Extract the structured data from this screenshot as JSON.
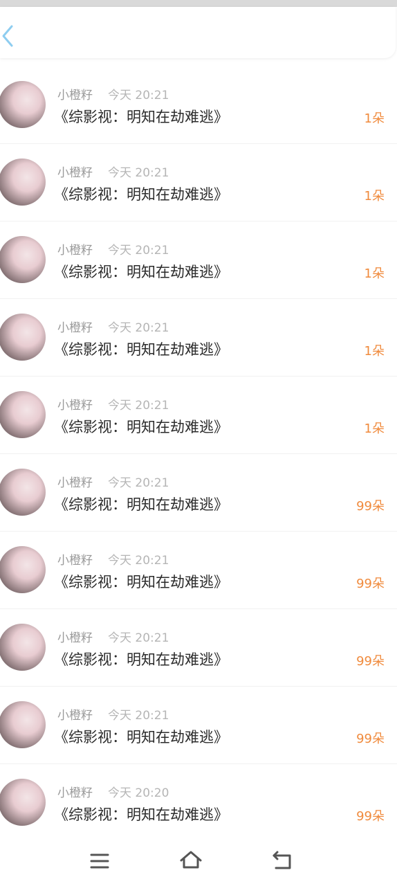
{
  "header": {
    "back_icon": "chevron-left-icon"
  },
  "colors": {
    "amount": "#f08a3c",
    "back_icon": "#8ecdf0",
    "nav_icon": "#555555"
  },
  "items": [
    {
      "user": "小橙籽",
      "time": "今天 20:21",
      "title": "《综影视：明知在劫难逃》",
      "amount": "1朵"
    },
    {
      "user": "小橙籽",
      "time": "今天 20:21",
      "title": "《综影视：明知在劫难逃》",
      "amount": "1朵"
    },
    {
      "user": "小橙籽",
      "time": "今天 20:21",
      "title": "《综影视：明知在劫难逃》",
      "amount": "1朵"
    },
    {
      "user": "小橙籽",
      "time": "今天 20:21",
      "title": "《综影视：明知在劫难逃》",
      "amount": "1朵"
    },
    {
      "user": "小橙籽",
      "time": "今天 20:21",
      "title": "《综影视：明知在劫难逃》",
      "amount": "1朵"
    },
    {
      "user": "小橙籽",
      "time": "今天 20:21",
      "title": "《综影视：明知在劫难逃》",
      "amount": "99朵"
    },
    {
      "user": "小橙籽",
      "time": "今天 20:21",
      "title": "《综影视：明知在劫难逃》",
      "amount": "99朵"
    },
    {
      "user": "小橙籽",
      "time": "今天 20:21",
      "title": "《综影视：明知在劫难逃》",
      "amount": "99朵"
    },
    {
      "user": "小橙籽",
      "time": "今天 20:21",
      "title": "《综影视：明知在劫难逃》",
      "amount": "99朵"
    },
    {
      "user": "小橙籽",
      "time": "今天 20:20",
      "title": "《综影视：明知在劫难逃》",
      "amount": "99朵"
    }
  ],
  "navbar": {
    "menu_icon": "menu-icon",
    "home_icon": "home-icon",
    "back_icon": "system-back-icon"
  }
}
